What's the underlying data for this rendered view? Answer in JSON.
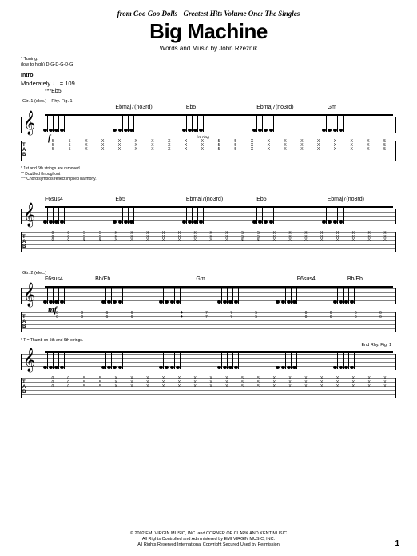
{
  "header": {
    "source_line": "from Goo Goo Dolls - Greatest Hits Volume One: The Singles",
    "title": "Big Machine",
    "composer": "Words and Music by John Rzeznik"
  },
  "tuning": {
    "label": "* Tuning:",
    "detail": "(low to high) D-G-D-G-D-G"
  },
  "intro": {
    "section": "Intro",
    "tempo_label": "Moderately",
    "tempo_note": "♩ = 109",
    "first_chord": "***Eb5",
    "gtr_label": "Gtr. 1 (elec.)",
    "rhy_label": "Rhy. Fig. 1"
  },
  "systems": [
    {
      "chords": [
        "",
        "Ebmaj7(no3rd)",
        "Eb5",
        "Ebmaj7(no3rd)",
        "Gm"
      ],
      "dynamic": "f",
      "let_ring": "let ring",
      "tab_values": [
        "5",
        "5",
        "X",
        "X",
        "X",
        "X",
        "X",
        "X",
        "X",
        "X",
        "5",
        "5",
        "X",
        "X",
        "X",
        "X",
        "X",
        "X",
        "X",
        "X",
        "5"
      ],
      "footnotes": [
        "* 1st and 6th strings are removed.",
        "** Doubled throughout",
        "*** Chord symbols reflect implied harmony."
      ]
    },
    {
      "chords": [
        "F6sus4",
        "Eb5",
        "Ebmaj7(no3rd)",
        "Eb5",
        "Ebmaj7(no3rd)"
      ],
      "tab_values": [
        "0",
        "0",
        "5",
        "5",
        "X",
        "X",
        "X",
        "X",
        "X",
        "X",
        "X",
        "X",
        "5",
        "5",
        "X",
        "X",
        "X",
        "X",
        "X",
        "X",
        "X",
        "X"
      ]
    },
    {
      "gtr2_label": "Gtr. 2 (elec.)",
      "chords": [
        "F6sus4",
        "Bb/Eb",
        "",
        "Gm",
        "",
        "F6sus4",
        "Bb/Eb"
      ],
      "dynamic": "mf",
      "tab_top": [
        "0",
        "0",
        "6",
        "6",
        "",
        "4",
        "7",
        "7",
        "5",
        "",
        "0",
        "0",
        "6",
        "6"
      ],
      "tab_bot": [
        "3",
        "3",
        "",
        "",
        "",
        "",
        "",
        "",
        "",
        "",
        "3",
        "3",
        "",
        ""
      ],
      "footnote": "* T = Thumb on 5th and 6th strings.",
      "end_label": "End Rhy. Fig. 1"
    }
  ],
  "copyright": {
    "line1": "© 2002 EMI VIRGIN MUSIC, INC. and CORNER OF CLARK AND KENT MUSIC",
    "line2": "All Rights Controlled and Administered by EMI VIRGIN MUSIC, INC.",
    "line3": "All Rights Reserved   International Copyright Secured   Used by Permission"
  },
  "page_number": "1"
}
